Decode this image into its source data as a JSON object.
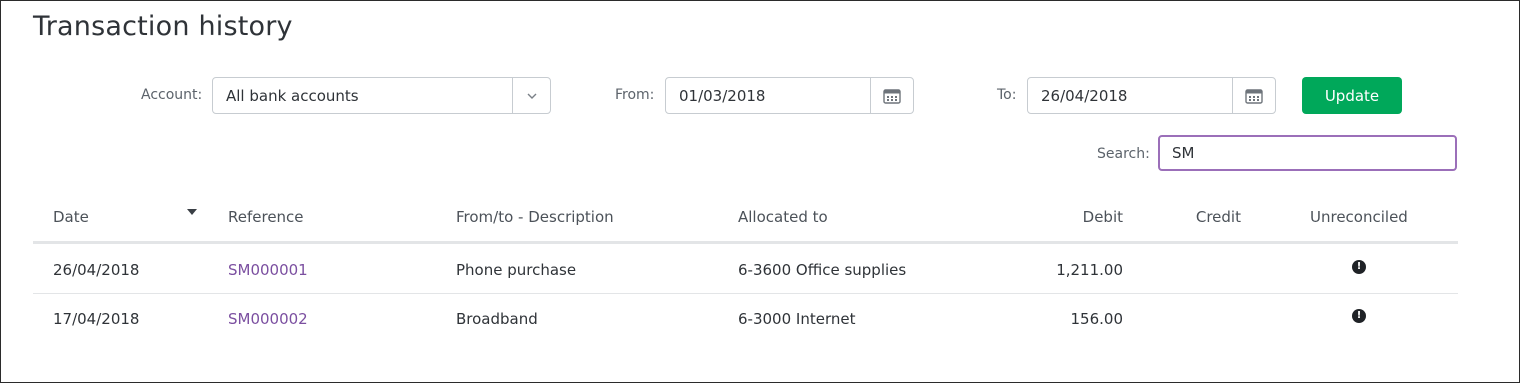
{
  "page": {
    "title": "Transaction history"
  },
  "filters": {
    "account_label": "Account:",
    "account_value": "All bank accounts",
    "from_label": "From:",
    "from_value": "01/03/2018",
    "to_label": "To:",
    "to_value": "26/04/2018",
    "update_label": "Update",
    "search_label": "Search:",
    "search_value": "SM"
  },
  "icons": {
    "account_dropdown": "chevron-down-icon",
    "from_picker": "calendar-icon",
    "to_picker": "calendar-icon",
    "sort": "sort-descending-icon",
    "unreconciled": "alert-icon"
  },
  "colors": {
    "accent": "#00a85a",
    "link": "#7b4fa0",
    "search_focus": "#9b6fb9"
  },
  "table": {
    "columns": [
      "Date",
      "Reference",
      "From/to - Description",
      "Allocated to",
      "Debit",
      "Credit",
      "Unreconciled"
    ],
    "rows": [
      {
        "date": "26/04/2018",
        "reference": "SM000001",
        "description": "Phone purchase",
        "allocated": "6-3600 Office supplies",
        "debit": "1,211.00",
        "credit": "",
        "unreconciled": "!"
      },
      {
        "date": "17/04/2018",
        "reference": "SM000002",
        "description": "Broadband",
        "allocated": "6-3000 Internet",
        "debit": "156.00",
        "credit": "",
        "unreconciled": "!"
      }
    ]
  }
}
